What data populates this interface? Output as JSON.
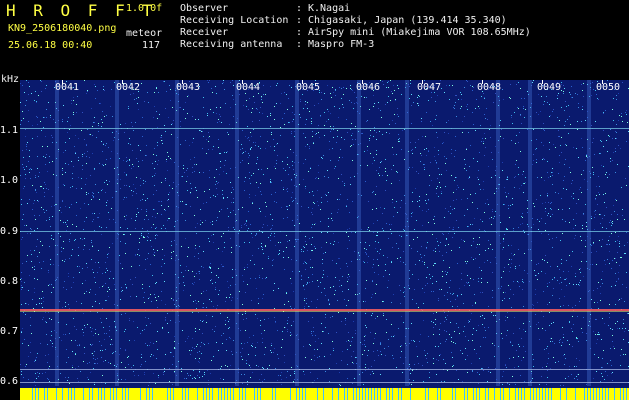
{
  "header": {
    "app_title": "H R O F F T",
    "version": "1.0.0f",
    "filename": "KN9_2506180040.png",
    "detect_label": "meteor",
    "timestamp": "25.06.18 00:40",
    "count": "117"
  },
  "meta": [
    {
      "label": "Observer",
      "value": "K.Nagai"
    },
    {
      "label": "Receiving Location",
      "value": "Chigasaki, Japan (139.414 35.340)"
    },
    {
      "label": "Receiver",
      "value": "AirSpy mini (Miakejima VOR 108.65MHz)"
    },
    {
      "label": "Receiving antenna",
      "value": "Maspro FM-3"
    }
  ],
  "axis": {
    "unit": "kHz",
    "y_ticks": [
      "1.1",
      "1.0",
      "0.9",
      "0.8",
      "0.7",
      "0.6"
    ],
    "x_ticks": [
      "0041",
      "0042",
      "0043",
      "0044",
      "0045",
      "0046",
      "0047",
      "0048",
      "0049",
      "0050"
    ]
  },
  "colors": {
    "background": "#000000",
    "spectrogram_bg": "#0a1a6e",
    "header_yellow": "#ffff44",
    "header_white": "#f0f0f0",
    "signal_line": "#ff6060",
    "noise_cyan": "#40d0ff",
    "bottom_bar": "#ffff00"
  }
}
